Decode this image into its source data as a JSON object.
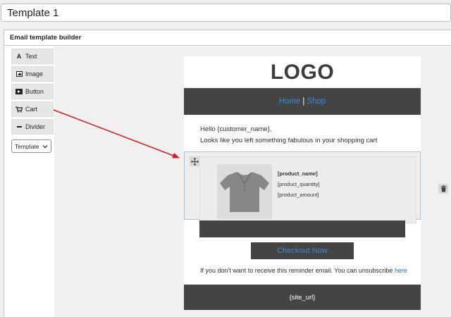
{
  "title": {
    "value": "Template 1"
  },
  "builder": {
    "heading": "Email template builder",
    "tools": [
      {
        "label": "Text",
        "icon": "A"
      },
      {
        "label": "Image"
      },
      {
        "label": "Button"
      },
      {
        "label": "Cart"
      },
      {
        "label": "Divider"
      }
    ],
    "template_select": {
      "value": "Template"
    }
  },
  "email": {
    "logo": "LOGO",
    "nav": {
      "home": "Home",
      "separator": "|",
      "shop": "Shop"
    },
    "greeting_line1": "Hello {customer_name},",
    "greeting_line2": "Looks like you left something fabulous in your shopping cart",
    "cart": {
      "product_name": "[product_name]",
      "product_quantity": "[product_quantity]",
      "product_amount": "[product_amount]"
    },
    "checkout_label": "Checkout Now",
    "unsubscribe_text": "If you don't want to receive this reminder email. You can unsubscribe ",
    "unsubscribe_link": "here",
    "footer": "{site_url}"
  },
  "colors": {
    "accent_link": "#3a8bd8",
    "dark_band": "#444444",
    "arrow": "#e0191f",
    "drop_outline": "#9fc4e8"
  },
  "icons": {
    "move": "move-icon",
    "trash": "trash-icon",
    "shirt": "tshirt-icon"
  }
}
